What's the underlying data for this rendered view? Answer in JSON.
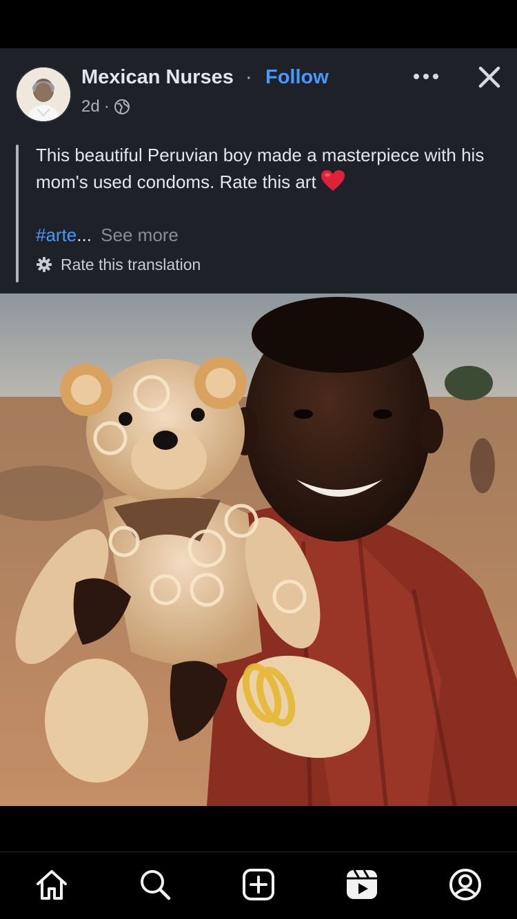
{
  "post": {
    "author": "Mexican Nurses",
    "separator": "·",
    "follow_label": "Follow",
    "time": "2d",
    "meta_separator": "·",
    "audience_icon": "globe-icon",
    "caption": "This beautiful Peruvian boy made a masterpiece with his mom's used condoms. Rate this art",
    "caption_emoji": "heart-icon",
    "hashtag": "#arte",
    "ellipsis": "...",
    "see_more": "See more",
    "translation_label": "Rate this translation"
  },
  "tabs": [
    {
      "name": "home",
      "icon": "home-icon"
    },
    {
      "name": "search",
      "icon": "search-icon"
    },
    {
      "name": "create",
      "icon": "create-icon"
    },
    {
      "name": "reels",
      "icon": "reels-icon"
    },
    {
      "name": "profile",
      "icon": "profile-icon"
    }
  ],
  "colors": {
    "background": "#000000",
    "post_background": "#1f2128",
    "link": "#4599ff",
    "text": "#e4e6eb",
    "secondary_text": "#b0b3b8",
    "heart": "#e0213a"
  }
}
